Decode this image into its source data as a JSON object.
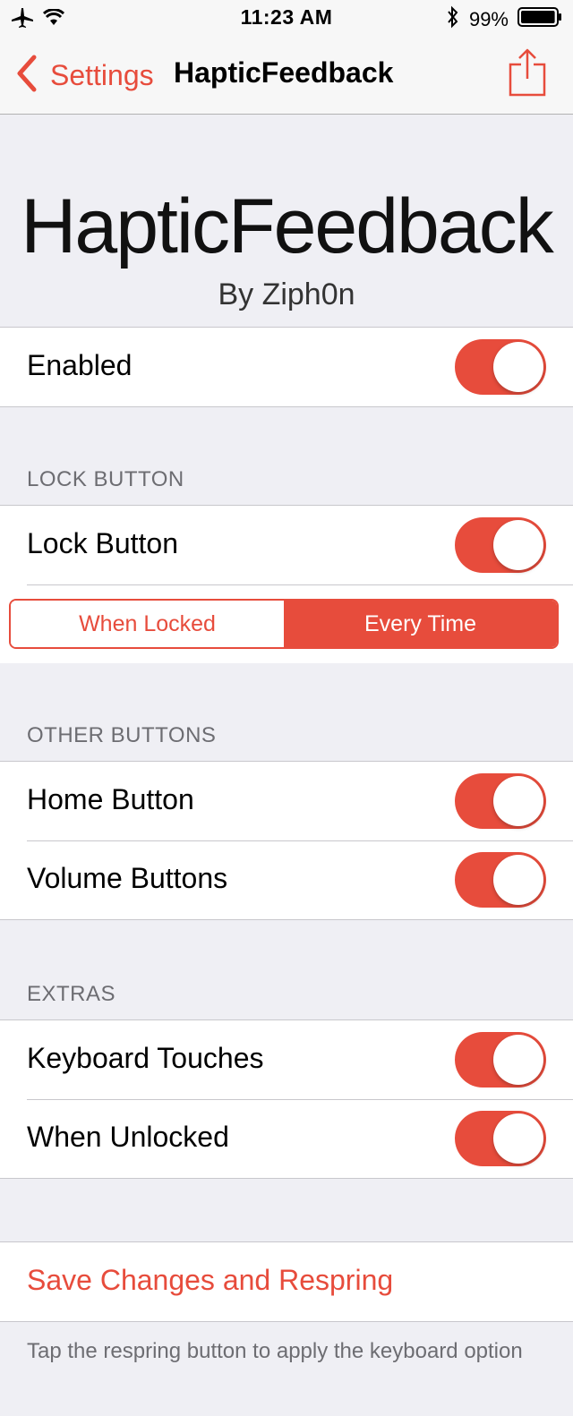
{
  "status_bar": {
    "time": "11:23 AM",
    "battery_percent": "99%",
    "battery_level": 0.99,
    "icons": [
      "airplane-icon",
      "wifi-icon",
      "bluetooth-icon",
      "battery-icon"
    ]
  },
  "nav": {
    "back_label": "Settings",
    "title": "HapticFeedback",
    "share_icon": "share-icon"
  },
  "header": {
    "title": "HapticFeedback",
    "subtitle": "By Ziph0n"
  },
  "general": {
    "enabled_label": "Enabled",
    "enabled_on": true
  },
  "lock_section": {
    "header": "LOCK BUTTON",
    "lock_button_label": "Lock Button",
    "lock_button_on": true,
    "segments": [
      "When Locked",
      "Every Time"
    ],
    "selected_segment": "Every Time"
  },
  "other_section": {
    "header": "OTHER BUTTONS",
    "home_label": "Home Button",
    "home_on": true,
    "volume_label": "Volume Buttons",
    "volume_on": true
  },
  "extras_section": {
    "header": "EXTRAS",
    "keyboard_label": "Keyboard Touches",
    "keyboard_on": true,
    "unlocked_label": "When Unlocked",
    "unlocked_on": true
  },
  "actions": {
    "respring_label": "Save Changes and Respring",
    "footer": "Tap the respring button to apply the keyboard option"
  },
  "colors": {
    "accent": "#e74c3c",
    "background": "#efeff4",
    "section_text": "#6d6d72"
  }
}
